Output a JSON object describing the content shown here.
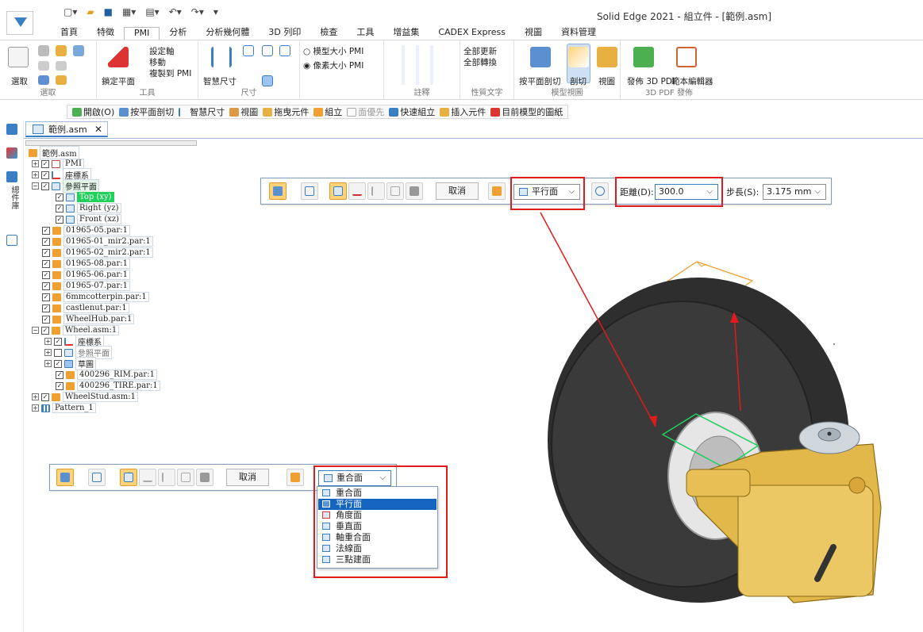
{
  "window": {
    "title": "Solid Edge 2021 - 組立件 - [範例.asm]"
  },
  "ribbon_tabs": [
    "首頁",
    "特徵",
    "PMI",
    "分析",
    "分析幾何體",
    "3D 列印",
    "檢查",
    "工具",
    "增益集",
    "CADEX Express",
    "視圖",
    "資料管理"
  ],
  "active_tab": "PMI",
  "ribbon": {
    "select_label": "選取",
    "select_group": "選取",
    "lock_plane": "鎖定平面",
    "set_axis": "設定軸",
    "move": "移動",
    "copy_to_pmi": "複製到 PMI",
    "tools_group": "工具",
    "smart_dim": "智慧尺寸",
    "dim_group": "尺寸",
    "model_size_pmi": "模型大小 PMI",
    "pixel_size_pmi": "像素大小 PMI",
    "annot_group": "註釋",
    "update_all": "全部更新",
    "convert_all": "全部轉換",
    "prop_text_group": "性質文字",
    "cut_by_plane": "按平面剖切",
    "cut": "剖切",
    "view": "視圖",
    "model_view_group": "模型視圖",
    "publish_3d_pdf": "發佈 3D PDF",
    "template_editor": "範本編輯器",
    "pdf_group": "3D PDF 發佈"
  },
  "command_bar": [
    "開啟(O)",
    "按平面剖切",
    "智慧尺寸",
    "視圖",
    "拖曳元件",
    "組立",
    "面優先",
    "快速組立",
    "插入元件",
    "目前模型的圖紙"
  ],
  "left_strip_label": "總件庫",
  "document_tab": "範例.asm",
  "tree": {
    "root": "範例.asm",
    "pmi": "PMI",
    "coord": "座標系",
    "refplane": "參照平面",
    "top": "Top (xy)",
    "right": "Right (yz)",
    "front": "Front (xz)",
    "parts": [
      "01965-05.par:1",
      "01965-01_mir2.par:1",
      "01965-02_mir2.par:1",
      "01965-08.par:1",
      "01965-06.par:1",
      "01965-07.par:1",
      "6mmcotterpin.par:1",
      "castlenut.par:1",
      "WheelHub.par:1"
    ],
    "wheel": "Wheel.asm:1",
    "wheel_coord": "座標系",
    "wheel_refplane": "參照平面",
    "wheel_group": "草圖",
    "rim": "400296_RIM.par:1",
    "tire": "400296_TIRE.par:1",
    "wheelstud": "WheelStud.asm:1",
    "pattern": "Pattern_1"
  },
  "top_toolbar": {
    "cancel": "取消",
    "plane_type": "平行面",
    "distance_label": "距離(D):",
    "distance_value": "300.0",
    "step_label": "步長(S):",
    "step_value": "3.175 mm"
  },
  "bottom_toolbar": {
    "cancel": "取消",
    "plane_type": "重合面"
  },
  "plane_options": [
    "重合面",
    "平行面",
    "角度面",
    "垂直面",
    "軸重合面",
    "法線面",
    "三點建面"
  ],
  "highlighted_option": "平行面",
  "colors": {
    "accent": "#3a7fc4",
    "selection_green": "#1fd05a",
    "callout_red": "#e11b1b",
    "plane_orange": "#f0a030",
    "tire": "#2e2e2e",
    "brass": "#e2b84a"
  }
}
